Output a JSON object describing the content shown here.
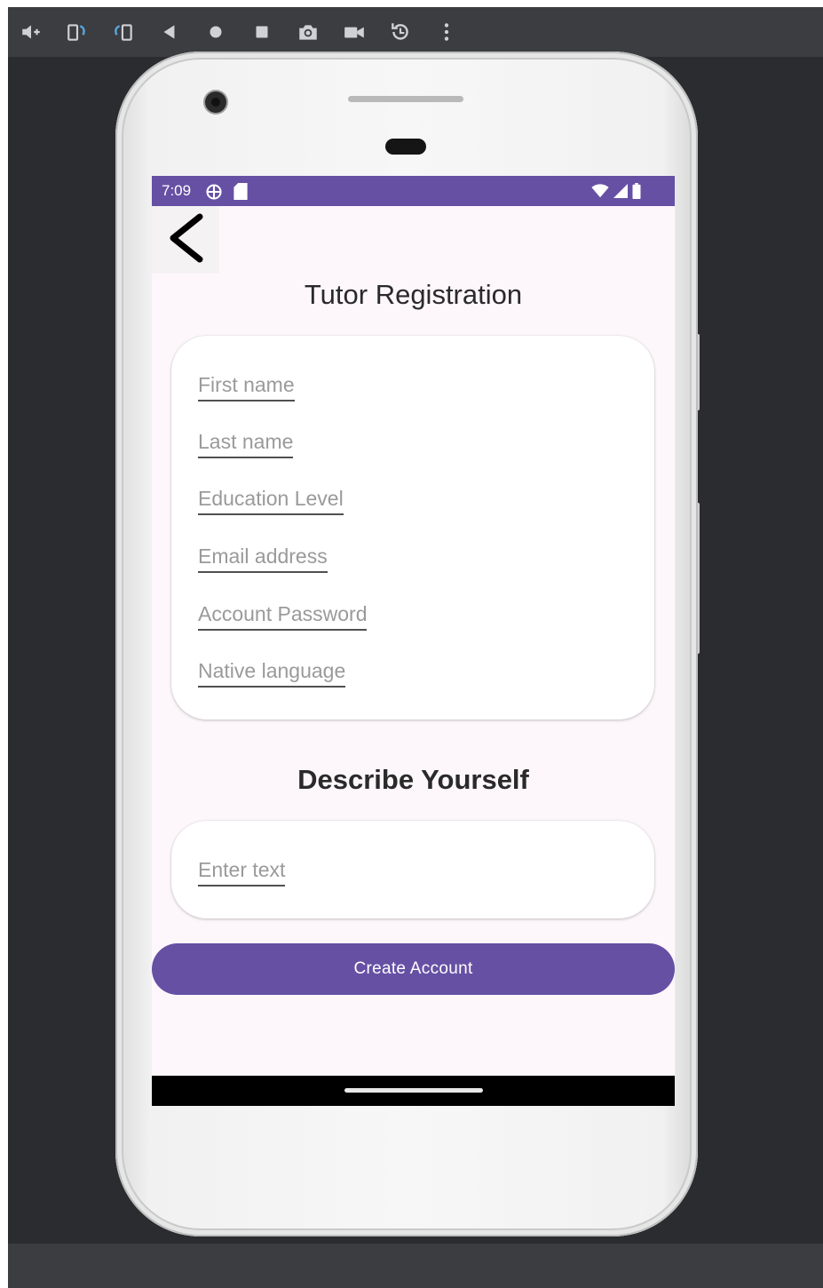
{
  "emulator_toolbar": {
    "buttons": [
      "volume-up-icon",
      "rotate-left-icon",
      "rotate-right-icon",
      "back-icon",
      "home-icon",
      "overview-icon",
      "camera-icon",
      "video-icon",
      "snapshot-icon",
      "more-icon"
    ]
  },
  "status_bar": {
    "time": "7:09",
    "left_icons": [
      "vpn-icon",
      "sd-card-icon"
    ],
    "right_icons": [
      "wifi-icon",
      "signal-icon",
      "battery-icon"
    ],
    "color": "#6650a4"
  },
  "screen": {
    "title": "Tutor Registration",
    "fields": [
      {
        "name": "first-name-field",
        "placeholder": "First name"
      },
      {
        "name": "last-name-field",
        "placeholder": "Last name"
      },
      {
        "name": "education-level-field",
        "placeholder": "Education Level"
      },
      {
        "name": "email-address-field",
        "placeholder": "Email address"
      },
      {
        "name": "account-password-field",
        "placeholder": "Account Password"
      },
      {
        "name": "native-language-field",
        "placeholder": "Native language"
      }
    ],
    "describe_title": "Describe Yourself",
    "describe_placeholder": "Enter text",
    "create_button": "Create Account",
    "accent_color": "#6650a4"
  }
}
